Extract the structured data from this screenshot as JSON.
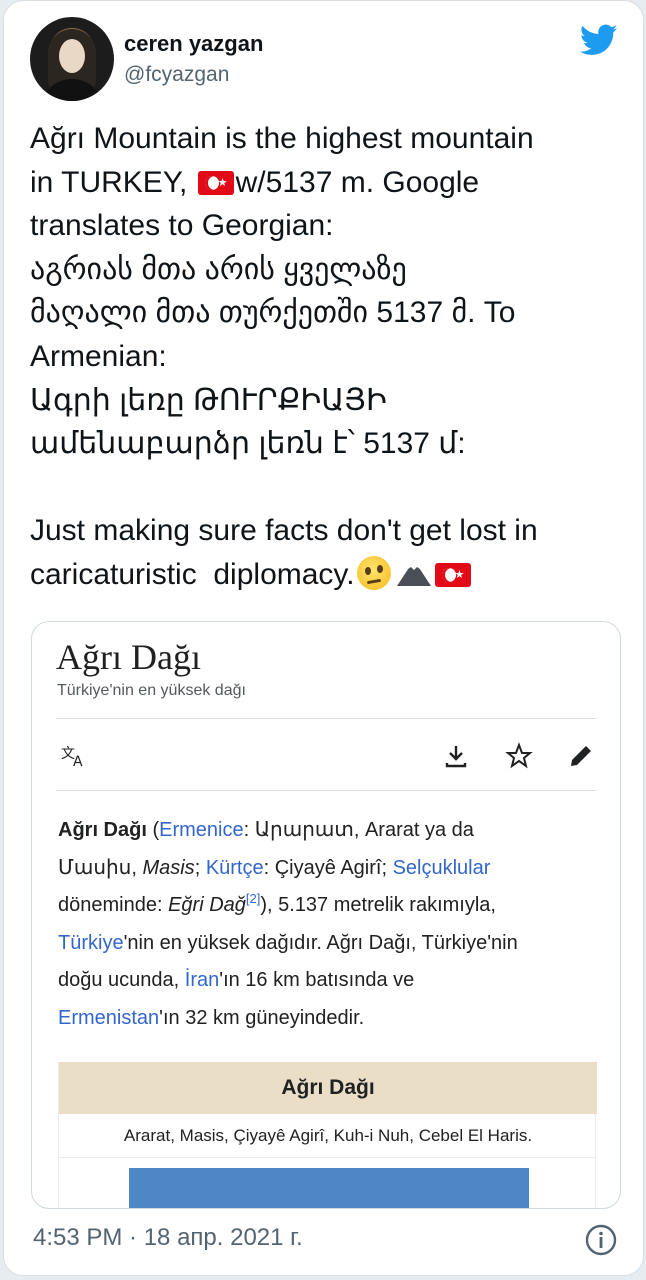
{
  "tweet": {
    "author_name": "ceren yazgan",
    "author_handle": "@fcyazgan",
    "text_line1": "Ağrı Mountain is the highest mountain",
    "text_line2a": "in TURKEY, ",
    "text_line2b": "w/5137 m. Google",
    "text_line3": "translates to Georgian:",
    "text_line4": "აგრიას მთა არის ყველაზე",
    "text_line5": "მაღალი მთა თურქეთში 5137 მ. To",
    "text_line6": "Armenian:",
    "text_line7": "Ագրի լեռը ԹՈՒՐՔԻԱՅԻ",
    "text_line8": "ամենաբարձր լեռն է՝ 5137 մ:",
    "text_line9": "Just making sure facts don't get lost in",
    "text_line10": "caricaturistic  diplomacy.",
    "timestamp": "4:53 PM · 18 апр. 2021 г.",
    "icons": [
      "twitter-bird-icon",
      "turkey-flag-icon",
      "face-with-rolling-eyes-icon",
      "snow-capped-mountain-icon",
      "info-icon"
    ],
    "brand_color": "#1d9bf0"
  },
  "wiki": {
    "title": "Ağrı Dağı",
    "subtitle": "Türkiye'nin en yüksek dağı",
    "icons": [
      "translate-icon",
      "download-icon",
      "star-icon",
      "edit-pencil-icon"
    ],
    "body": {
      "bold_name": "Ağrı Dağı",
      "p1": " (",
      "link_ermenice": "Ermenice",
      "p2": ": Արարատ, Ararat ya da",
      "p3": "Մասիս, ",
      "masis": "Masis",
      "p4": "; ",
      "link_kurtce": "Kürtçe",
      "p5": ": Çiyayê Agirî; ",
      "link_selcuklular": "Selçuklular",
      "p6": "döneminde: ",
      "egri": "Eğri Dağ",
      "ref": "[2]",
      "p7": "), 5.137 metrelik rakımıyla,",
      "link_turkiye": "Türkiye",
      "p8": "'nin en yüksek dağıdır. Ağrı Dağı, Türkiye'nin",
      "p9": "doğu ucunda, ",
      "link_iran": "İran",
      "p10": "'ın 16 km batısında ve",
      "link_ermenistan": "Ermenistan",
      "p11": "'ın 32 km güneyindedir."
    },
    "infobox": {
      "title": "Ağrı Dağı",
      "names": "Ararat, Masis, Çiyayê Agirî, Kuh-i Nuh, Cebel El Haris."
    },
    "link_color": "#3366cc",
    "infobox_header_color": "#eadfc6"
  }
}
